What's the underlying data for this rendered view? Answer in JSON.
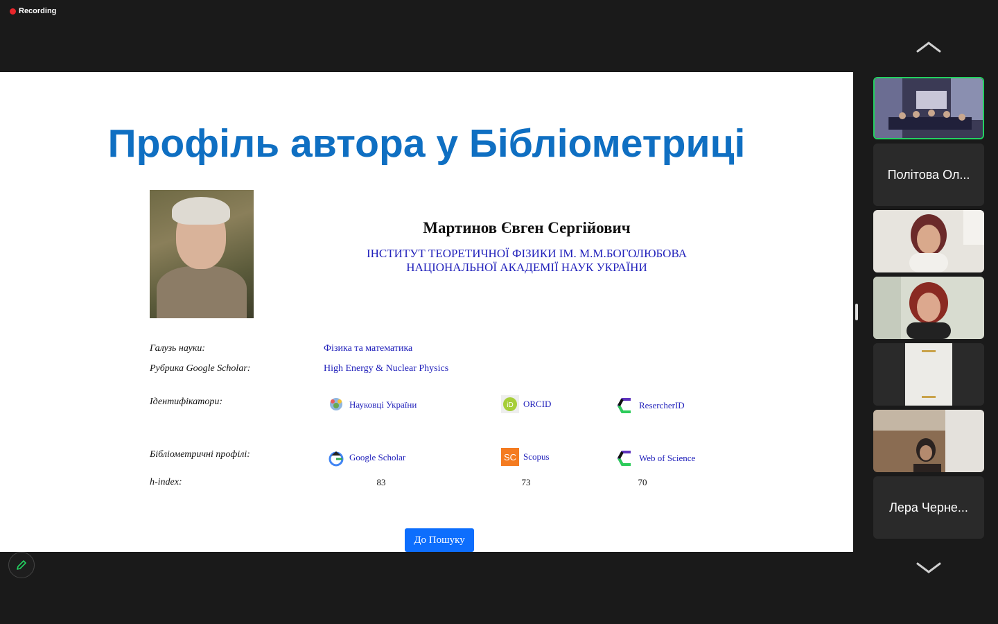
{
  "recording": {
    "label": "Recording",
    "color": "#e8262b"
  },
  "slide": {
    "title": "Профіль автора у Бібліометриці",
    "author_name": "Мартинов Євген Сергійович",
    "institution_line1": "ІНСТИТУТ ТЕОРЕТИЧНОЇ ФІЗИКИ ІМ. М.М.БОГОЛЮБОВА",
    "institution_line2": "НАЦІОНАЛЬНОЇ АКАДЕМІЇ НАУК УКРАЇНИ",
    "field_label": "Галузь науки:",
    "field_value": "Фізика та математика",
    "rubric_label": "Рубрика Google Scholar:",
    "rubric_value": "High Energy & Nuclear Physics",
    "ids_label": "Ідентифікатори:",
    "ids": [
      "Науковці України",
      "ORCID",
      "ResercherID"
    ],
    "profiles_label": "Бібліометричні профілі:",
    "profiles": [
      "Google Scholar",
      "Scopus",
      "Web of Science"
    ],
    "hindex_label": "h-index:",
    "hindex": [
      "83",
      "73",
      "70"
    ],
    "search_button": "До Пошуку",
    "title_color": "#0f6fc2",
    "link_color": "#2222bb",
    "button_color": "#0d6efd"
  },
  "participants": [
    {
      "name": ""
    },
    {
      "name": "Політова Ол..."
    },
    {
      "name": ""
    },
    {
      "name": ""
    },
    {
      "name": ""
    },
    {
      "name": ""
    },
    {
      "name": "Лера Черне..."
    }
  ],
  "icons": {
    "scroll_up": "chevron-up-icon",
    "scroll_down": "chevron-down-icon",
    "annotate": "pencil-icon"
  }
}
